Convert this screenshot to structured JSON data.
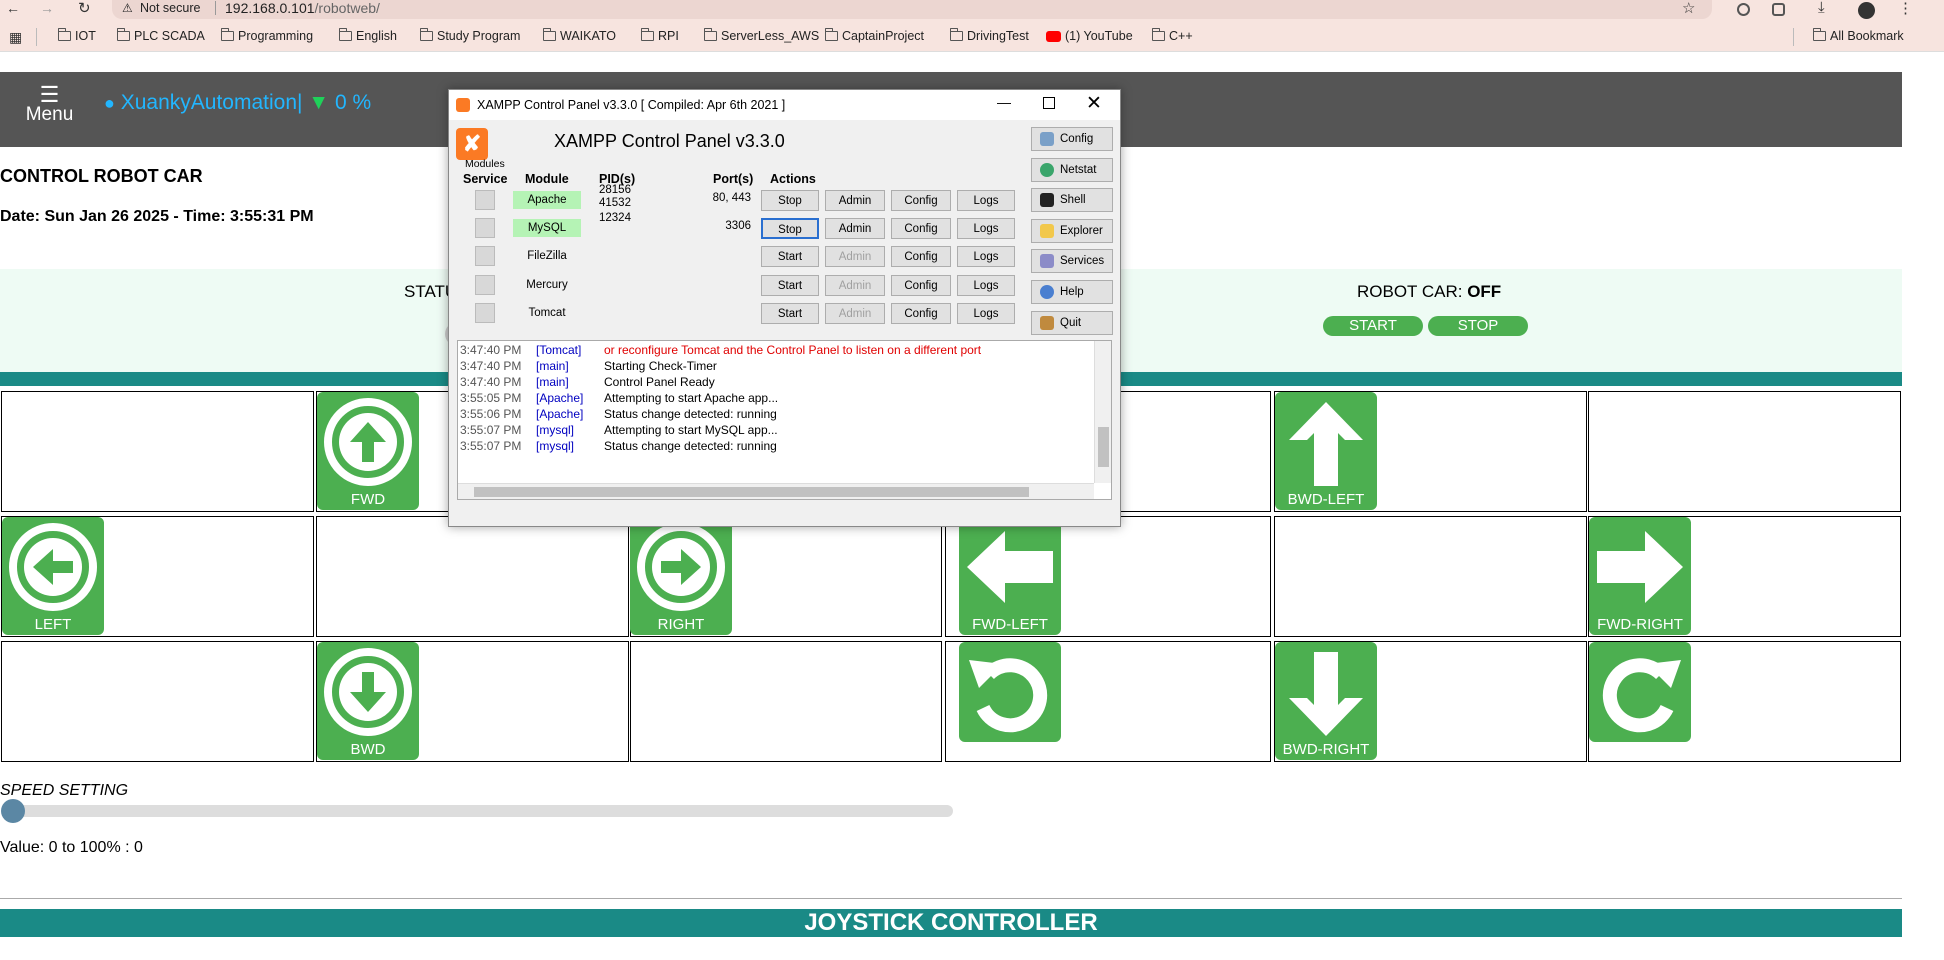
{
  "browser": {
    "security_label": "Not secure",
    "url_host": "192.168.0.101",
    "url_path": "/robotweb/",
    "bookmarks": [
      "IOT",
      "PLC SCADA",
      "Programming",
      "English",
      "Study Program",
      "WAIKATO",
      "RPI",
      "ServerLess_AWS",
      "CaptainProject",
      "DrivingTest",
      "(1) YouTube",
      "C++"
    ],
    "all_bookmarks_label": "All Bookmark"
  },
  "app": {
    "menu_label": "Menu",
    "brand": "XuankyAutomation|",
    "wifi_percent": "0 %",
    "title": "CONTROL ROBOT CAR",
    "date_line": "Date: Sun Jan 26 2025 - Time: 3:55:31 PM",
    "status_label": "STATU",
    "robot_car_label": "ROBOT CAR: ",
    "robot_car_state": "OFF",
    "start_label": "START",
    "stop_label": "STOP",
    "controls": {
      "fwd": "FWD",
      "bwd_left": "BWD-LEFT",
      "left": "LEFT",
      "right": "RIGHT",
      "fwd_left": "FWD-LEFT",
      "fwd_right": "FWD-RIGHT",
      "bwd": "BWD",
      "bwd_right": "BWD-RIGHT"
    },
    "speed_label": "SPEED SETTING",
    "speed_value": 0,
    "value_line": "Value: 0 to 100% : 0",
    "joystick_title": "JOYSTICK CONTROLLER"
  },
  "xampp": {
    "window_title": "XAMPP Control Panel v3.3.0   [ Compiled: Apr 6th 2021 ]",
    "heading": "XAMPP Control Panel v3.3.0",
    "modules_label": "Modules",
    "headers": {
      "service": "Service",
      "module": "Module",
      "pids": "PID(s)",
      "ports": "Port(s)",
      "actions": "Actions"
    },
    "rows": [
      {
        "module": "Apache",
        "pid1": "28156",
        "pid2": "41532",
        "ports": "80, 443",
        "action": "Stop",
        "admin": "Admin",
        "config": "Config",
        "logs": "Logs"
      },
      {
        "module": "MySQL",
        "pid1": "12324",
        "pid2": "",
        "ports": "3306",
        "action": "Stop",
        "admin": "Admin",
        "config": "Config",
        "logs": "Logs"
      },
      {
        "module": "FileZilla",
        "pid1": "",
        "pid2": "",
        "ports": "",
        "action": "Start",
        "admin": "Admin",
        "config": "Config",
        "logs": "Logs"
      },
      {
        "module": "Mercury",
        "pid1": "",
        "pid2": "",
        "ports": "",
        "action": "Start",
        "admin": "Admin",
        "config": "Config",
        "logs": "Logs"
      },
      {
        "module": "Tomcat",
        "pid1": "",
        "pid2": "",
        "ports": "",
        "action": "Start",
        "admin": "Admin",
        "config": "Config",
        "logs": "Logs"
      }
    ],
    "side_buttons": {
      "config": "Config",
      "netstat": "Netstat",
      "shell": "Shell",
      "explorer": "Explorer",
      "services": "Services",
      "help": "Help",
      "quit": "Quit"
    },
    "log": [
      {
        "time": "3:47:40 PM",
        "src": "[Tomcat]",
        "msg": "or reconfigure Tomcat and the Control Panel to listen on a different port",
        "error": true
      },
      {
        "time": "3:47:40 PM",
        "src": "[main]",
        "msg": "Starting Check-Timer",
        "error": false
      },
      {
        "time": "3:47:40 PM",
        "src": "[main]",
        "msg": "Control Panel Ready",
        "error": false
      },
      {
        "time": "3:55:05 PM",
        "src": "[Apache]",
        "msg": "Attempting to start Apache app...",
        "error": false
      },
      {
        "time": "3:55:06 PM",
        "src": "[Apache]",
        "msg": "Status change detected: running",
        "error": false
      },
      {
        "time": "3:55:07 PM",
        "src": "[mysql]",
        "msg": "Attempting to start MySQL app...",
        "error": false
      },
      {
        "time": "3:55:07 PM",
        "src": "[mysql]",
        "msg": "Status change detected: running",
        "error": false
      }
    ],
    "colors": {
      "running_bg": "#b5f3b5",
      "error_text": "#e00000",
      "source_text": "#0000c0",
      "brand_orange": "#fb7a24"
    }
  }
}
